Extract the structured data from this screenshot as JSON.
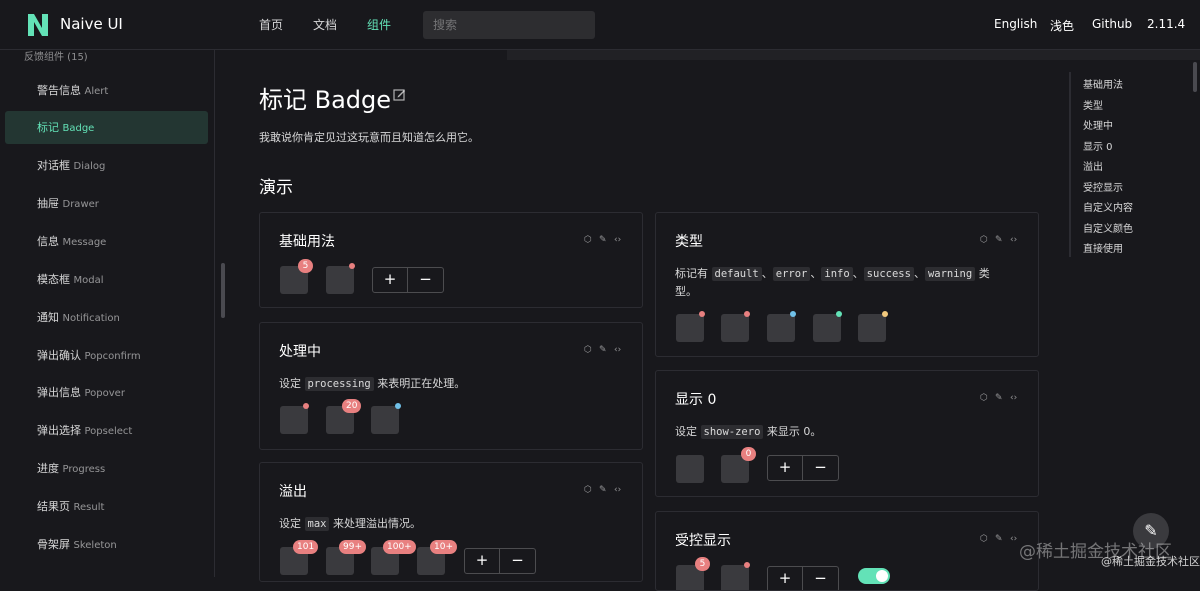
{
  "header": {
    "brand": "Naive UI",
    "nav": [
      "首页",
      "文档",
      "组件"
    ],
    "search_placeholder": "搜索",
    "right_nav": [
      "English",
      "浅色",
      "Github",
      "2.11.4"
    ]
  },
  "sidebar": {
    "group_title": "反馈组件 (15)",
    "items": [
      {
        "cn": "警告信息",
        "en": "Alert"
      },
      {
        "cn": "标记",
        "en": "Badge"
      },
      {
        "cn": "对话框",
        "en": "Dialog"
      },
      {
        "cn": "抽屉",
        "en": "Drawer"
      },
      {
        "cn": "信息",
        "en": "Message"
      },
      {
        "cn": "模态框",
        "en": "Modal"
      },
      {
        "cn": "通知",
        "en": "Notification"
      },
      {
        "cn": "弹出确认",
        "en": "Popconfirm"
      },
      {
        "cn": "弹出信息",
        "en": "Popover"
      },
      {
        "cn": "弹出选择",
        "en": "Popselect"
      },
      {
        "cn": "进度",
        "en": "Progress"
      },
      {
        "cn": "结果页",
        "en": "Result"
      },
      {
        "cn": "骨架屏",
        "en": "Skeleton"
      }
    ]
  },
  "page": {
    "title": "标记 Badge",
    "description": "我敢说你肯定见过这玩意而且知道怎么用它。",
    "section": "演示"
  },
  "cards": {
    "basic": {
      "title": "基础用法",
      "badge": "5",
      "plus": "+",
      "minus": "−"
    },
    "processing": {
      "title": "处理中",
      "pre": "设定 ",
      "code": "processing",
      "post": " 来表明正在处理。",
      "badge": "20"
    },
    "overflow": {
      "title": "溢出",
      "pre": "设定 ",
      "code": "max",
      "post": " 来处理溢出情况。",
      "badges": [
        "101",
        "99+",
        "100+",
        "10+"
      ],
      "plus": "+",
      "minus": "−"
    },
    "types": {
      "title": "类型",
      "pre": "标记有 ",
      "codes": [
        "default",
        "error",
        "info",
        "success",
        "warning"
      ],
      "sep": "、",
      "post": " 类型。"
    },
    "show_zero": {
      "title": "显示 0",
      "pre": "设定 ",
      "code": "show-zero",
      "post": " 来显示 0。",
      "badge": "0",
      "plus": "+",
      "minus": "−"
    },
    "controlled": {
      "title": "受控显示",
      "badge": "5",
      "plus": "+",
      "minus": "−"
    }
  },
  "anchor": [
    "基础用法",
    "类型",
    "处理中",
    "显示 0",
    "溢出",
    "受控显示",
    "自定义内容",
    "自定义颜色",
    "直接使用"
  ],
  "watermark": {
    "main": "@稀土掘金技术社区",
    "small": "@稀土掘金技术社区"
  },
  "colors": {
    "accent": "#63e2b7",
    "error": "#e88080",
    "info": "#70c0e8",
    "success": "#63e2b7",
    "warning": "#f2c97d",
    "default": "#e88080"
  },
  "icons": [
    "logo-icon",
    "edit-icon",
    "code-box-icon",
    "code-icon",
    "pen-icon"
  ]
}
